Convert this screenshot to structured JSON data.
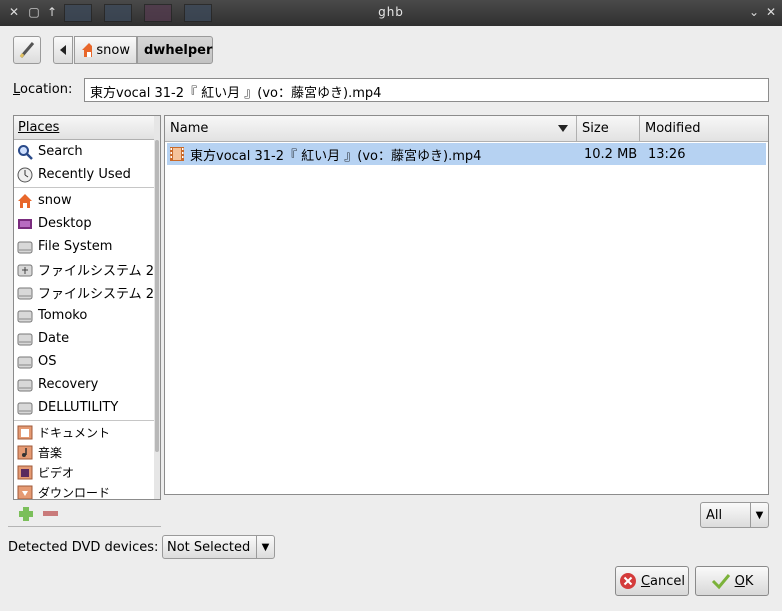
{
  "window": {
    "title": "ghb"
  },
  "toolbar": {
    "edit_icon": "pencil-icon",
    "back_icon": "left-arrow-icon",
    "path": [
      {
        "label": "snow",
        "icon": "home-folder-icon"
      },
      {
        "label": "dwhelper",
        "active": true
      }
    ]
  },
  "location": {
    "label": "Location:",
    "value": "東方vocal 31-2『 紅い月 』(vo：藤宮ゆき).mp4"
  },
  "places": {
    "header": "Places",
    "items": [
      {
        "label": "Search",
        "icon": "search-icon"
      },
      {
        "label": "Recently Used",
        "icon": "clock-icon"
      },
      {
        "label": "snow",
        "icon": "home-folder-icon"
      },
      {
        "label": "Desktop",
        "icon": "desktop-icon"
      },
      {
        "label": "File System",
        "icon": "drive-icon"
      },
      {
        "label": "ファイルシステム 2…",
        "icon": "usb-drive-icon"
      },
      {
        "label": "ファイルシステム 2…",
        "icon": "drive-icon"
      },
      {
        "label": "Tomoko",
        "icon": "drive-icon"
      },
      {
        "label": "Date",
        "icon": "drive-icon"
      },
      {
        "label": "OS",
        "icon": "drive-icon"
      },
      {
        "label": "Recovery",
        "icon": "drive-icon"
      },
      {
        "label": "DELLUTILITY",
        "icon": "drive-icon"
      }
    ],
    "bookmarks": [
      {
        "label": "ドキュメント",
        "icon": "documents-folder-icon"
      },
      {
        "label": "音楽",
        "icon": "music-folder-icon"
      },
      {
        "label": "ビデオ",
        "icon": "video-folder-icon"
      },
      {
        "label": "ダウンロード",
        "icon": "downloads-folder-icon"
      }
    ]
  },
  "files": {
    "columns": {
      "name": "Name",
      "size": "Size",
      "modified": "Modified"
    },
    "rows": [
      {
        "name": "東方vocal 31-2『 紅い月 』(vo：藤宮ゆき).mp4",
        "size": "10.2 MB",
        "modified": "13:26",
        "icon": "video-file-icon",
        "selected": true
      }
    ]
  },
  "filter": {
    "value": "All"
  },
  "dvd": {
    "label": "Detected DVD devices:",
    "value": "Not Selected"
  },
  "buttons": {
    "cancel": "Cancel",
    "ok": "OK"
  },
  "colors": {
    "selection": "#b6d2f2",
    "titlebar": "#3a3a3a"
  }
}
